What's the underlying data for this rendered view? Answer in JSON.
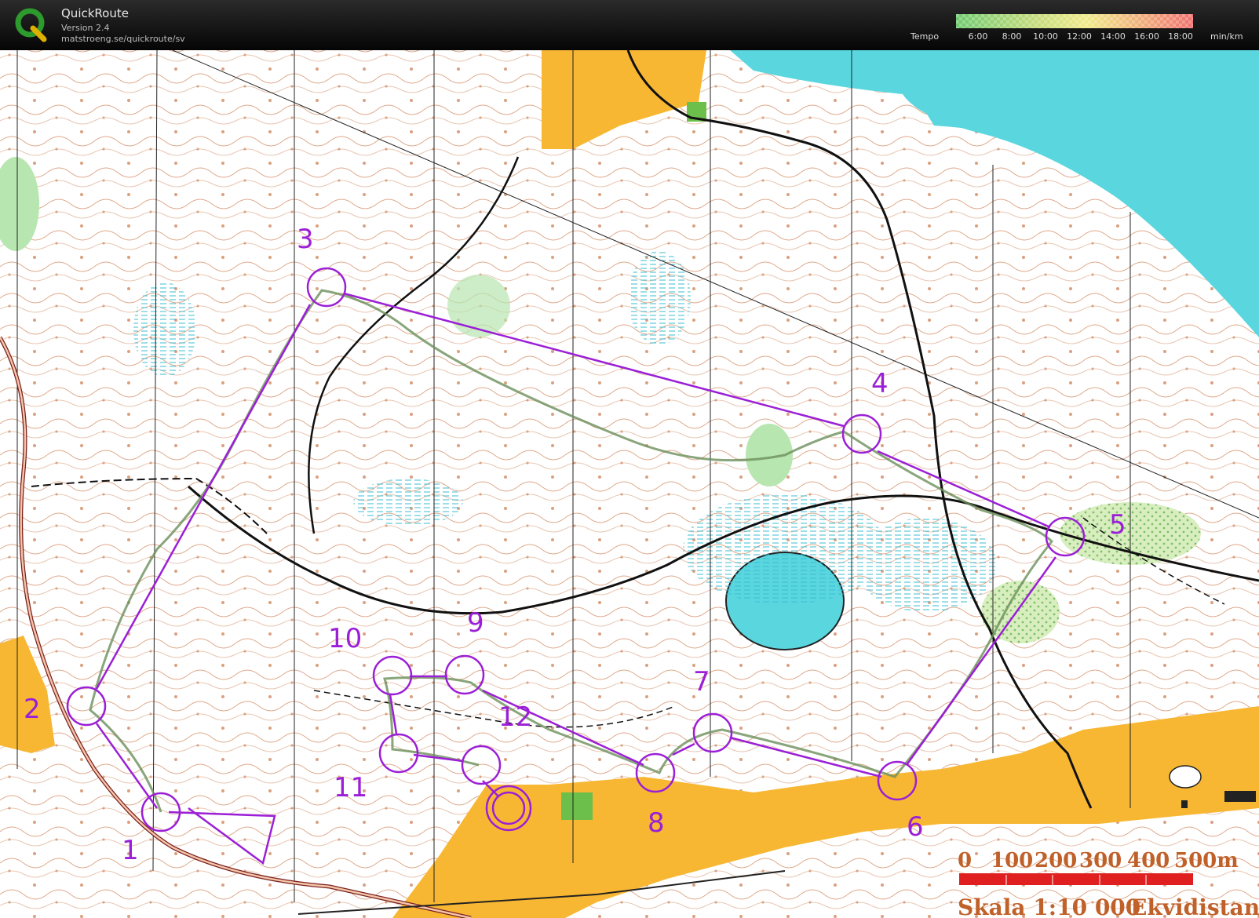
{
  "app": {
    "name": "QuickRoute",
    "version": "Version 2.4",
    "url": "matstroeng.se/quickroute/sv"
  },
  "legend": {
    "label": "Tempo",
    "ticks": [
      "6:00",
      "8:00",
      "10:00",
      "12:00",
      "14:00",
      "16:00",
      "18:00"
    ],
    "unit": "min/km"
  },
  "map": {
    "controls": [
      "1",
      "2",
      "3",
      "4",
      "5",
      "6",
      "7",
      "8",
      "9",
      "10",
      "11",
      "12"
    ],
    "scale_bar": {
      "labels": [
        "0",
        "100",
        "200",
        "300",
        "400",
        "500m"
      ],
      "caption": "Skala 1:10 000",
      "caption2": "Ekvidistans"
    }
  },
  "colors": {
    "course": "#9b1fd6",
    "water": "#5ad6df",
    "open_land": "#f7b733",
    "forest_green": "#b8e6b0",
    "contour": "#c0612a",
    "scale_red": "#e02020"
  }
}
